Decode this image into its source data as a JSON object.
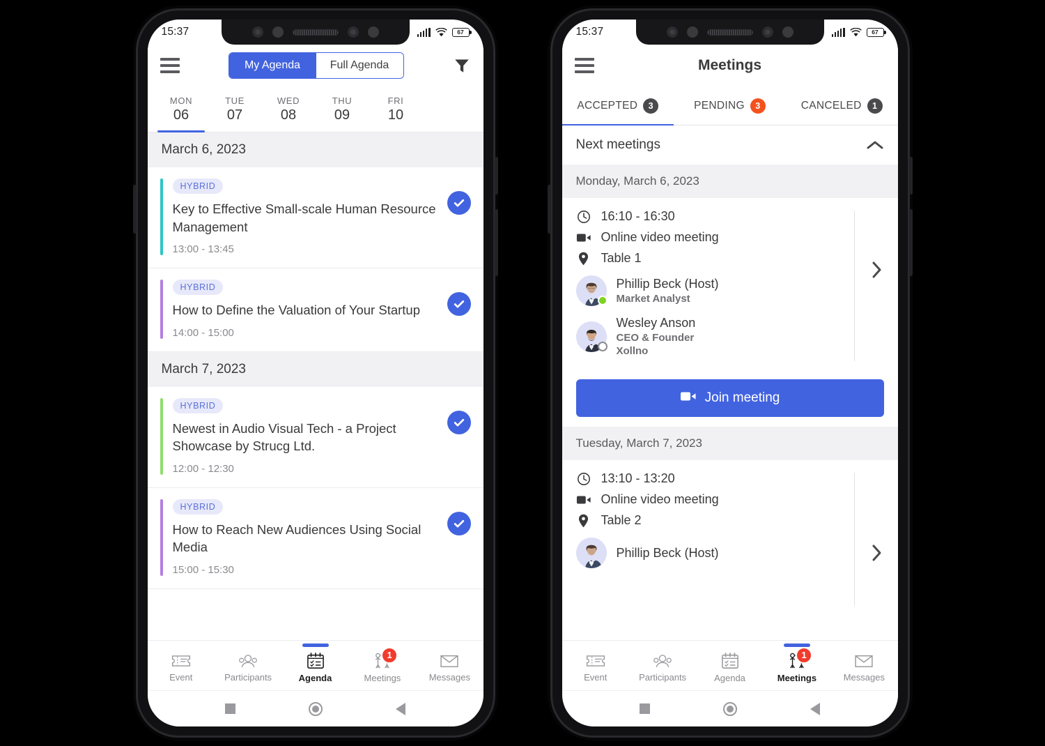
{
  "status_bar": {
    "time": "15:37",
    "battery": "67",
    "signal_icon": "signal-bars-icon",
    "wifi_icon": "wifi-icon",
    "battery_icon": "battery-icon"
  },
  "theme": {
    "accent_blue": "#4263e0",
    "badge_bg": "#e7e9fa",
    "badge_text": "#5a6fd8",
    "orange_badge": "#f4511e",
    "red_badge": "#f03b2d",
    "online_green": "#7ed321",
    "header_grey": "#f1f1f3"
  },
  "agenda_phone": {
    "menu_icon": "hamburger-menu-icon",
    "filter_icon": "filter-icon",
    "segmented": {
      "options": [
        "My Agenda",
        "Full Agenda"
      ],
      "selected": "My Agenda"
    },
    "days": [
      {
        "dow": "MON",
        "num": "06",
        "active": true
      },
      {
        "dow": "TUE",
        "num": "07",
        "active": false
      },
      {
        "dow": "WED",
        "num": "08",
        "active": false
      },
      {
        "dow": "THU",
        "num": "09",
        "active": false
      },
      {
        "dow": "FRI",
        "num": "10",
        "active": false
      }
    ],
    "groups": [
      {
        "date": "March 6, 2023",
        "items": [
          {
            "badge": "HYBRID",
            "title": "Key to Effective Small-scale Human Resource Management",
            "time": "13:00 - 13:45",
            "bar_color": "#2ec5c5",
            "checked": true
          },
          {
            "badge": "HYBRID",
            "title": "How to Define the Valuation of Your Startup",
            "time": "14:00 - 15:00",
            "bar_color": "#b57fe0",
            "checked": true
          }
        ]
      },
      {
        "date": "March 7, 2023",
        "items": [
          {
            "badge": "HYBRID",
            "title": "Newest in Audio Visual Tech - a Project Showcase by Strucg Ltd.",
            "time": "12:00 - 12:30",
            "bar_color": "#8fdd6e",
            "checked": true
          },
          {
            "badge": "HYBRID",
            "title": "How to Reach New Audiences Using Social Media",
            "time": "15:00 - 15:30",
            "bar_color": "#b57fe0",
            "checked": true
          }
        ]
      }
    ],
    "bottom_nav": [
      {
        "label": "Event",
        "icon": "ticket-icon",
        "active": false,
        "badge": null
      },
      {
        "label": "Participants",
        "icon": "people-icon",
        "active": false,
        "badge": null
      },
      {
        "label": "Agenda",
        "icon": "calendar-checklist-icon",
        "active": true,
        "badge": null
      },
      {
        "label": "Meetings",
        "icon": "handshake-icon",
        "active": false,
        "badge": "1"
      },
      {
        "label": "Messages",
        "icon": "envelope-icon",
        "active": false,
        "badge": null
      }
    ]
  },
  "meetings_phone": {
    "menu_icon": "hamburger-menu-icon",
    "title": "Meetings",
    "tabs": [
      {
        "label": "ACCEPTED",
        "count": "3",
        "badge_style": "dark",
        "active": true
      },
      {
        "label": "PENDING",
        "count": "3",
        "badge_style": "orange",
        "active": false
      },
      {
        "label": "CANCELED",
        "count": "1",
        "badge_style": "dark",
        "active": false
      }
    ],
    "section": {
      "title": "Next meetings",
      "collapse_icon": "chevron-up-icon"
    },
    "meetings": [
      {
        "date": "Monday, March 6, 2023",
        "time": "16:10 - 16:30",
        "type": "Online video meeting",
        "location": "Table 1",
        "clock_icon": "clock-icon",
        "video_icon": "video-camera-icon",
        "pin_icon": "location-pin-icon",
        "chevron_icon": "chevron-right-icon",
        "participants": [
          {
            "name": "Phillip Beck (Host)",
            "role": "Market Analyst",
            "org": "",
            "status": "online"
          },
          {
            "name": "Wesley Anson",
            "role": "CEO & Founder",
            "org": "Xollno",
            "status": "offline"
          }
        ],
        "join_label": "Join meeting",
        "join_icon": "video-camera-icon"
      },
      {
        "date": "Tuesday, March 7, 2023",
        "time": "13:10 - 13:20",
        "type": "Online video meeting",
        "location": "Table 2",
        "clock_icon": "clock-icon",
        "video_icon": "video-camera-icon",
        "pin_icon": "location-pin-icon",
        "chevron_icon": "chevron-right-icon",
        "participants": [
          {
            "name": "Phillip Beck (Host)",
            "role": "",
            "org": "",
            "status": "online"
          }
        ]
      }
    ],
    "bottom_nav": [
      {
        "label": "Event",
        "icon": "ticket-icon",
        "active": false,
        "badge": null
      },
      {
        "label": "Participants",
        "icon": "people-icon",
        "active": false,
        "badge": null
      },
      {
        "label": "Agenda",
        "icon": "calendar-checklist-icon",
        "active": false,
        "badge": null
      },
      {
        "label": "Meetings",
        "icon": "handshake-icon",
        "active": true,
        "badge": "1"
      },
      {
        "label": "Messages",
        "icon": "envelope-icon",
        "active": false,
        "badge": null
      }
    ]
  },
  "system_nav": {
    "recents_icon": "square-icon",
    "home_icon": "circle-icon",
    "back_icon": "triangle-back-icon"
  }
}
